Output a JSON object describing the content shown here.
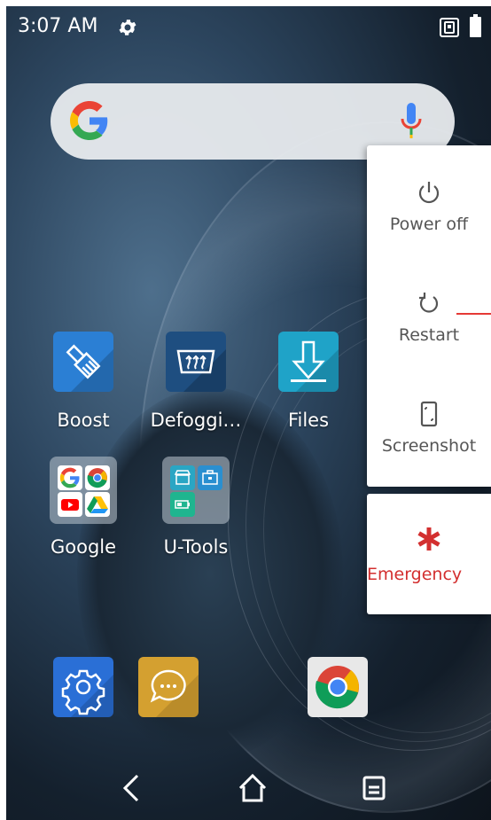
{
  "status_bar": {
    "time": "3:07 AM"
  },
  "apps": [
    {
      "label": "Boost",
      "icon": "broom-icon",
      "color": "#2b7fd4"
    },
    {
      "label": "Defoggi…",
      "icon": "defog-icon",
      "color": "#1e4e80"
    },
    {
      "label": "Files",
      "icon": "download-arrow-icon",
      "color": "#1fa3c8"
    }
  ],
  "folders": [
    {
      "label": "Google",
      "icons": [
        "google-icon",
        "chrome-icon",
        "youtube-icon",
        "drive-icon"
      ]
    },
    {
      "label": "U-Tools",
      "icons": [
        "store-icon",
        "toolbox-icon",
        "battery-app-icon"
      ]
    }
  ],
  "dock": [
    {
      "name": "settings-app",
      "icon": "gear-icon",
      "color": "#2a6fd6"
    },
    {
      "name": "messages-app",
      "icon": "chat-bubble-icon",
      "color": "#d4a030"
    },
    {
      "name": "chrome-app",
      "icon": "chrome-icon",
      "color": "#e8e8e8"
    }
  ],
  "power_menu": {
    "items": [
      {
        "label": "Power off",
        "icon": "power-icon"
      },
      {
        "label": "Restart",
        "icon": "restart-icon"
      },
      {
        "label": "Screenshot",
        "icon": "screenshot-icon"
      }
    ],
    "emergency": {
      "label": "Emergency",
      "icon": "asterisk-icon",
      "color": "#d32f2f"
    }
  }
}
